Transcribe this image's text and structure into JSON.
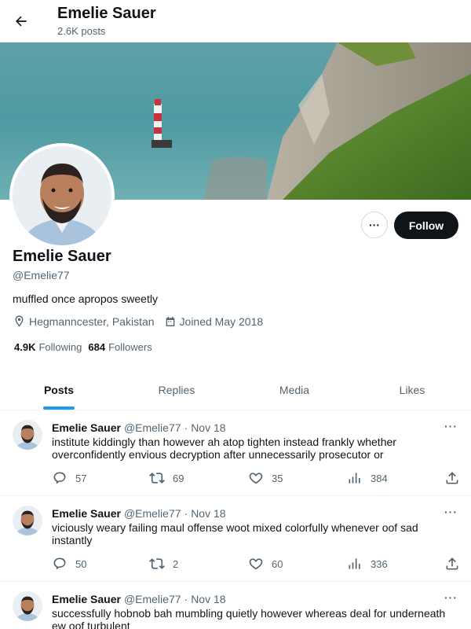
{
  "header": {
    "title": "Emelie Sauer",
    "post_count": "2.6K posts"
  },
  "profile": {
    "name": "Emelie Sauer",
    "handle": "@Emelie77",
    "bio": "muffled once apropos sweetly",
    "location": "Hegmanncester, Pakistan",
    "joined": "Joined May 2018",
    "following_count": "4.9K",
    "following_label": "Following",
    "followers_count": "684",
    "followers_label": "Followers",
    "more_label": "···",
    "follow_label": "Follow"
  },
  "tabs": [
    {
      "label": "Posts",
      "active": true
    },
    {
      "label": "Replies",
      "active": false
    },
    {
      "label": "Media",
      "active": false
    },
    {
      "label": "Likes",
      "active": false
    }
  ],
  "tweets": [
    {
      "name": "Emelie Sauer",
      "handle": "@Emelie77",
      "dot": "·",
      "date": "Nov 18",
      "more": "···",
      "text": "institute kiddingly than however ah atop tighten instead frankly whether overconfidently envious decryption after unnecessarily prosecutor or",
      "replies": "57",
      "retweets": "69",
      "likes": "35",
      "views": "384"
    },
    {
      "name": "Emelie Sauer",
      "handle": "@Emelie77",
      "dot": "·",
      "date": "Nov 18",
      "more": "···",
      "text": "viciously weary failing maul offense woot mixed colorfully whenever oof sad instantly",
      "replies": "50",
      "retweets": "2",
      "likes": "60",
      "views": "336"
    },
    {
      "name": "Emelie Sauer",
      "handle": "@Emelie77",
      "dot": "·",
      "date": "Nov 18",
      "more": "···",
      "text": "successfully hobnob bah mumbling quietly however whereas deal for underneath ew oof turbulent"
    }
  ],
  "colors": {
    "accent": "#1d9bf0",
    "text": "#0f1419",
    "muted": "#536471",
    "follow_bg": "#0f1419"
  }
}
